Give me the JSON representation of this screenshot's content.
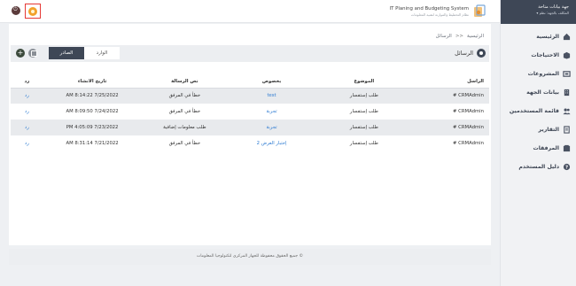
{
  "app": {
    "title": "IT Planing and Budgeting System",
    "subtitle": "نظام التخطيط والموازنة لتقنية المعلومات"
  },
  "user": {
    "name": "جهة بيانات متاحة",
    "role": "المكلف بالجهة: نظم"
  },
  "sidebar": {
    "items": [
      {
        "label": "الرئيسية",
        "icon": "home-icon"
      },
      {
        "label": "الاحتياجات",
        "icon": "box-icon"
      },
      {
        "label": "المشروعات",
        "icon": "projects-icon"
      },
      {
        "label": "بيانات الجهة",
        "icon": "building-icon"
      },
      {
        "label": "قائمة المستخدمين",
        "icon": "users-icon"
      },
      {
        "label": "التقارير",
        "icon": "reports-icon"
      },
      {
        "label": "المرفقات",
        "icon": "attachments-icon"
      },
      {
        "label": "دليل المستخدم",
        "icon": "help-icon"
      }
    ]
  },
  "breadcrumb": {
    "home": "الرئيسية",
    "sep": ">>",
    "current": "الرسائل"
  },
  "messages": {
    "title": "الرسائل",
    "tabs": {
      "inbox": "الوارد",
      "sent": "الصادر"
    }
  },
  "table": {
    "headers": {
      "sender": "الراسل",
      "subject": "الموضوع",
      "about": "بخصوص",
      "text": "نص الرسالة",
      "date": "تاريخ الانشاء",
      "reply": "رد"
    },
    "rows": [
      {
        "sender": "CRMAdmin #",
        "subject": "طلب إستفسار",
        "about": "test",
        "text": "خطأ في المرفق",
        "date": "7/25/2022 8:14:22 AM",
        "reply": "رد"
      },
      {
        "sender": "CRMAdmin #",
        "subject": "طلب إستفسار",
        "about": "تجربة",
        "text": "خطأ في المرفق",
        "date": "7/24/2022 8:09:50 AM",
        "reply": "رد"
      },
      {
        "sender": "CRMAdmin #",
        "subject": "طلب إستفسار",
        "about": "تجربة",
        "text": "طلب معلومات إضافية",
        "date": "7/23/2022 4:05:09 PM",
        "reply": "رد"
      },
      {
        "sender": "CRMAdmin #",
        "subject": "طلب إستفسار",
        "about": "إختبار العرض 2",
        "text": "خطأ في المرفق",
        "date": "7/21/2022 8:31:14 AM",
        "reply": "رد"
      }
    ]
  },
  "footer": {
    "text": "جميع الحقوق محفوظة للجهاز المركزي لتكنولوجيا المعلومات ©"
  },
  "colors": {
    "sidebar_header": "#3e4756",
    "accent_link": "#2d7bd2",
    "highlight_border": "#e53935"
  }
}
